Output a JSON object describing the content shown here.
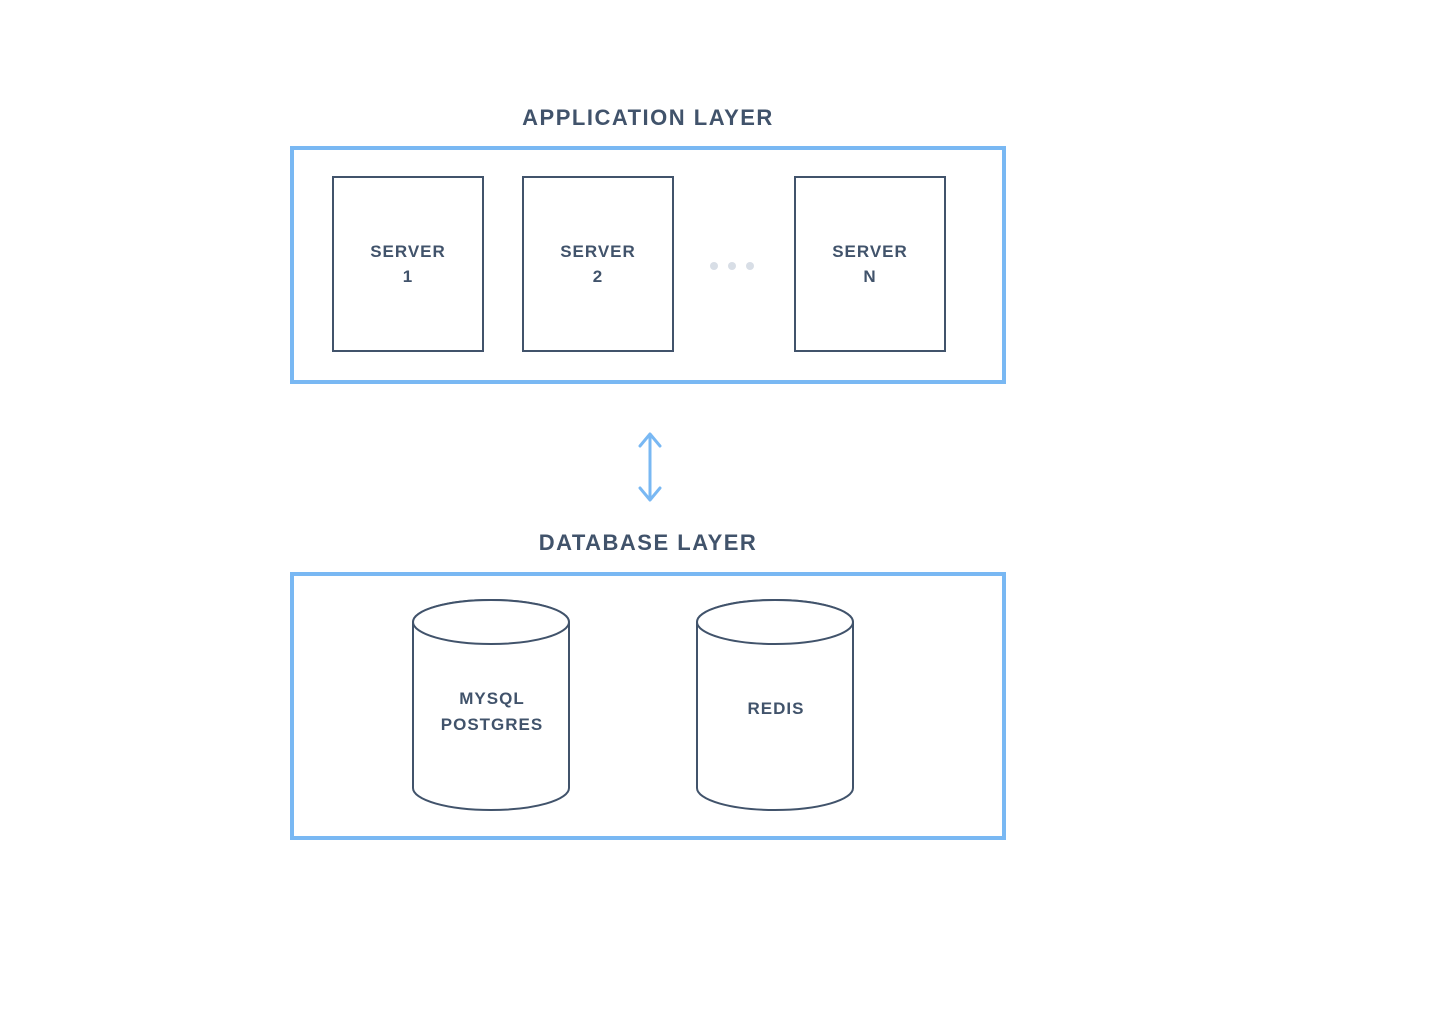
{
  "diagram": {
    "app_layer_title": "APPLICATION LAYER",
    "db_layer_title": "DATABASE  LAYER",
    "servers": [
      {
        "label": "SERVER\n1"
      },
      {
        "label": "SERVER\n2"
      },
      {
        "label": "SERVER\nN"
      }
    ],
    "databases": [
      {
        "label": "MYSQL\nPOSTGRES"
      },
      {
        "label": "REDIS"
      }
    ],
    "colors": {
      "border_blue": "#79b8f3",
      "text_slate": "#41536b",
      "dot_gray": "#d8dee6"
    }
  }
}
